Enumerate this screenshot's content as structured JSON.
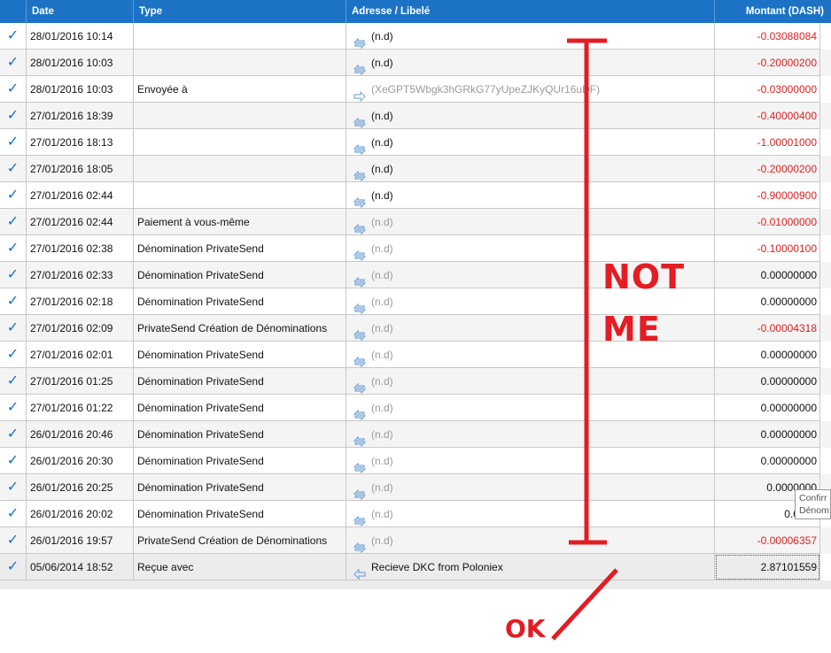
{
  "header": {
    "columns": [
      "",
      "Date",
      "Type",
      "Adresse / Libelé",
      "Montant (DASH)"
    ]
  },
  "rows": [
    {
      "date": "28/01/2016 10:14",
      "type": "",
      "address": "(n.d)",
      "amount": "-0.03088084",
      "amount_kind": "neg",
      "addr_kind": "bold",
      "icon": "recycle-icon"
    },
    {
      "date": "28/01/2016 10:03",
      "type": "",
      "address": "(n.d)",
      "amount": "-0.20000200",
      "amount_kind": "neg",
      "addr_kind": "bold",
      "icon": "recycle-icon"
    },
    {
      "date": "28/01/2016 10:03",
      "type": "Envoyée à",
      "address": "(XeGPT5Wbgk3hGRkG77yUpeZJKyQUr16uDF)",
      "amount": "-0.03000000",
      "amount_kind": "neg",
      "addr_kind": "muted",
      "icon": "arrow-right-icon"
    },
    {
      "date": "27/01/2016 18:39",
      "type": "",
      "address": "(n.d)",
      "amount": "-0.40000400",
      "amount_kind": "neg",
      "addr_kind": "bold",
      "icon": "recycle-icon"
    },
    {
      "date": "27/01/2016 18:13",
      "type": "",
      "address": "(n.d)",
      "amount": "-1.00001000",
      "amount_kind": "neg",
      "addr_kind": "bold",
      "icon": "recycle-icon"
    },
    {
      "date": "27/01/2016 18:05",
      "type": "",
      "address": "(n.d)",
      "amount": "-0.20000200",
      "amount_kind": "neg",
      "addr_kind": "bold",
      "icon": "recycle-icon"
    },
    {
      "date": "27/01/2016 02:44",
      "type": "",
      "address": "(n.d)",
      "amount": "-0.90000900",
      "amount_kind": "neg",
      "addr_kind": "bold",
      "icon": "recycle-icon"
    },
    {
      "date": "27/01/2016 02:44",
      "type": "Paiement à vous-même",
      "address": "(n.d)",
      "amount": "-0.01000000",
      "amount_kind": "neg",
      "addr_kind": "muted",
      "icon": "recycle-icon"
    },
    {
      "date": "27/01/2016 02:38",
      "type": "Dénomination PrivateSend",
      "address": "(n.d)",
      "amount": "-0.10000100",
      "amount_kind": "neg",
      "addr_kind": "muted",
      "icon": "recycle-icon"
    },
    {
      "date": "27/01/2016 02:33",
      "type": "Dénomination PrivateSend",
      "address": "(n.d)",
      "amount": "0.00000000",
      "amount_kind": "pos",
      "addr_kind": "muted",
      "icon": "recycle-icon"
    },
    {
      "date": "27/01/2016 02:18",
      "type": "Dénomination PrivateSend",
      "address": "(n.d)",
      "amount": "0.00000000",
      "amount_kind": "pos",
      "addr_kind": "muted",
      "icon": "recycle-icon"
    },
    {
      "date": "27/01/2016 02:09",
      "type": "PrivateSend Création de Dénominations",
      "address": "(n.d)",
      "amount": "-0.00004318",
      "amount_kind": "neg",
      "addr_kind": "muted",
      "icon": "recycle-icon"
    },
    {
      "date": "27/01/2016 02:01",
      "type": "Dénomination PrivateSend",
      "address": "(n.d)",
      "amount": "0.00000000",
      "amount_kind": "pos",
      "addr_kind": "muted",
      "icon": "recycle-icon"
    },
    {
      "date": "27/01/2016 01:25",
      "type": "Dénomination PrivateSend",
      "address": "(n.d)",
      "amount": "0.00000000",
      "amount_kind": "pos",
      "addr_kind": "muted",
      "icon": "recycle-icon"
    },
    {
      "date": "27/01/2016 01:22",
      "type": "Dénomination PrivateSend",
      "address": "(n.d)",
      "amount": "0.00000000",
      "amount_kind": "pos",
      "addr_kind": "muted",
      "icon": "recycle-icon"
    },
    {
      "date": "26/01/2016 20:46",
      "type": "Dénomination PrivateSend",
      "address": "(n.d)",
      "amount": "0.00000000",
      "amount_kind": "pos",
      "addr_kind": "muted",
      "icon": "recycle-icon"
    },
    {
      "date": "26/01/2016 20:30",
      "type": "Dénomination PrivateSend",
      "address": "(n.d)",
      "amount": "0.00000000",
      "amount_kind": "pos",
      "addr_kind": "muted",
      "icon": "recycle-icon"
    },
    {
      "date": "26/01/2016 20:25",
      "type": "Dénomination PrivateSend",
      "address": "(n.d)",
      "amount": "0.0000000",
      "amount_kind": "pos",
      "addr_kind": "muted",
      "icon": "recycle-icon"
    },
    {
      "date": "26/01/2016 20:02",
      "type": "Dénomination PrivateSend",
      "address": "(n.d)",
      "amount": "0.0000",
      "amount_kind": "pos",
      "addr_kind": "muted",
      "icon": "recycle-icon"
    },
    {
      "date": "26/01/2016 19:57",
      "type": "PrivateSend Création de Dénominations",
      "address": "(n.d)",
      "amount": "-0.00006357",
      "amount_kind": "neg",
      "addr_kind": "muted",
      "icon": "recycle-icon"
    },
    {
      "date": "05/06/2014 18:52",
      "type": "Reçue avec",
      "address": "Recieve DKC from Poloniex",
      "amount": "2.87101559",
      "amount_kind": "pos",
      "addr_kind": "normal",
      "icon": "arrow-left-icon"
    }
  ],
  "tooltip": {
    "line1": "Confirr",
    "line2": "Dénom"
  },
  "annotations": {
    "not_line1": "NOT",
    "not_line2": "ME",
    "ok": "OK"
  },
  "colors": {
    "header": "#1c73c5",
    "check": "#1a6fc2",
    "negative": "#e02020",
    "annotation": "#e41c23",
    "icon": "#7aa7d6"
  }
}
